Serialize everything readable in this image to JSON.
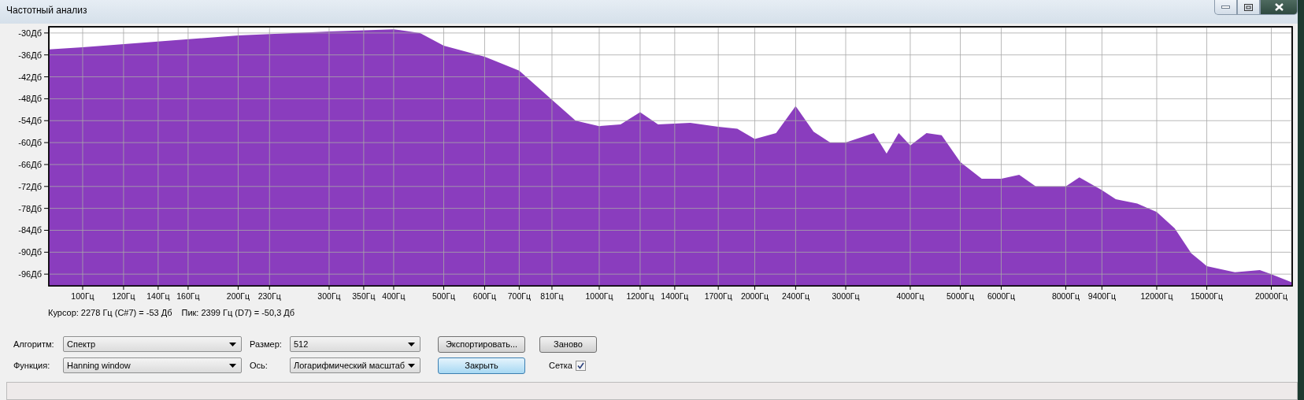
{
  "window": {
    "title": "Частотный анализ"
  },
  "plot": {
    "y_labels": [
      "-30Дб",
      "-36Дб",
      "-42Дб",
      "-48Дб",
      "-54Дб",
      "-60Дб",
      "-66Дб",
      "-72Дб",
      "-78Дб",
      "-84Дб",
      "-90Дб",
      "-96Дб"
    ],
    "x_labels": [
      "100Гц",
      "120Гц",
      "140Гц",
      "160Гц",
      "200Гц",
      "230Гц",
      "300Гц",
      "350Гц",
      "400Гц",
      "500Гц",
      "600Гц",
      "700Гц",
      "810Гц",
      "1000Гц",
      "1200Гц",
      "1400Гц",
      "1700Гц",
      "2000Гц",
      "2400Гц",
      "3000Гц",
      "4000Гц",
      "5000Гц",
      "6000Гц",
      "8000Гц",
      "9400Гц",
      "12000Гц",
      "15000Гц",
      "20000Гц"
    ]
  },
  "cursor_readout": "Курсор: 2278 Гц (C#7) = -53 Дб",
  "peak_readout": "Пик: 2399 Гц (D7) = -50,3 Дб",
  "algorithm": {
    "label": "Алгоритм:",
    "value": "Спектр"
  },
  "size": {
    "label": "Размер:",
    "value": "512"
  },
  "function": {
    "label": "Функция:",
    "value": "Hanning window"
  },
  "axis": {
    "label": "Ось:",
    "value": "Логарифмический масштаб"
  },
  "buttons": [
    {
      "label": "Экспортировать...",
      "focused": false
    },
    {
      "label": "Заново",
      "focused": false
    },
    {
      "label": "Закрыть",
      "focused": true
    }
  ],
  "grid_toggle": {
    "label": "Сетка",
    "checked": true
  }
}
